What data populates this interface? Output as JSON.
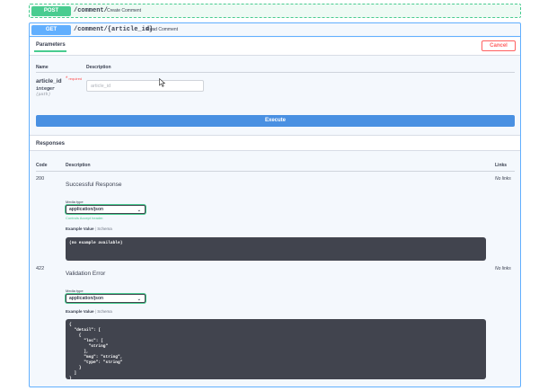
{
  "post_op": {
    "method": "POST",
    "path": "/comment/",
    "summary": "Create Comment"
  },
  "get_op": {
    "method": "GET",
    "path": "/comment/{article_id}",
    "summary": "Read Comment"
  },
  "parameters": {
    "tab_label": "Parameters",
    "cancel_label": "Cancel",
    "col_name": "Name",
    "col_description": "Description",
    "param": {
      "name": "article_id",
      "required_star": "*",
      "required_label": "required",
      "type": "integer",
      "in": "(path)",
      "placeholder": "article_id"
    }
  },
  "execute_label": "Execute",
  "responses": {
    "title": "Responses",
    "col_code": "Code",
    "col_description": "Description",
    "col_links": "Links",
    "items": [
      {
        "code": "200",
        "description": "Successful Response",
        "media_type_label": "Media type",
        "media_type": "application/json",
        "controls_note": "Controls Accept header.",
        "example_tab": "Example Value",
        "separator": "|",
        "schema_tab": "Schema",
        "example": "(no example available)",
        "links": "No links"
      },
      {
        "code": "422",
        "description": "Validation Error",
        "media_type_label": "Media type",
        "media_type": "application/json",
        "example_tab": "Example Value",
        "separator": "|",
        "schema_tab": "Schema",
        "example": "{\n  \"detail\": [\n    {\n      \"loc\": [\n        \"string\"\n      ],\n      \"msg\": \"string\",\n      \"type\": \"string\"\n    }\n  ]\n}",
        "links": "No links"
      }
    ]
  },
  "colors": {
    "post": "#49cc90",
    "get": "#61affe",
    "execute": "#4990e2",
    "cancel": "#ff6060",
    "code_bg": "#41444e"
  }
}
